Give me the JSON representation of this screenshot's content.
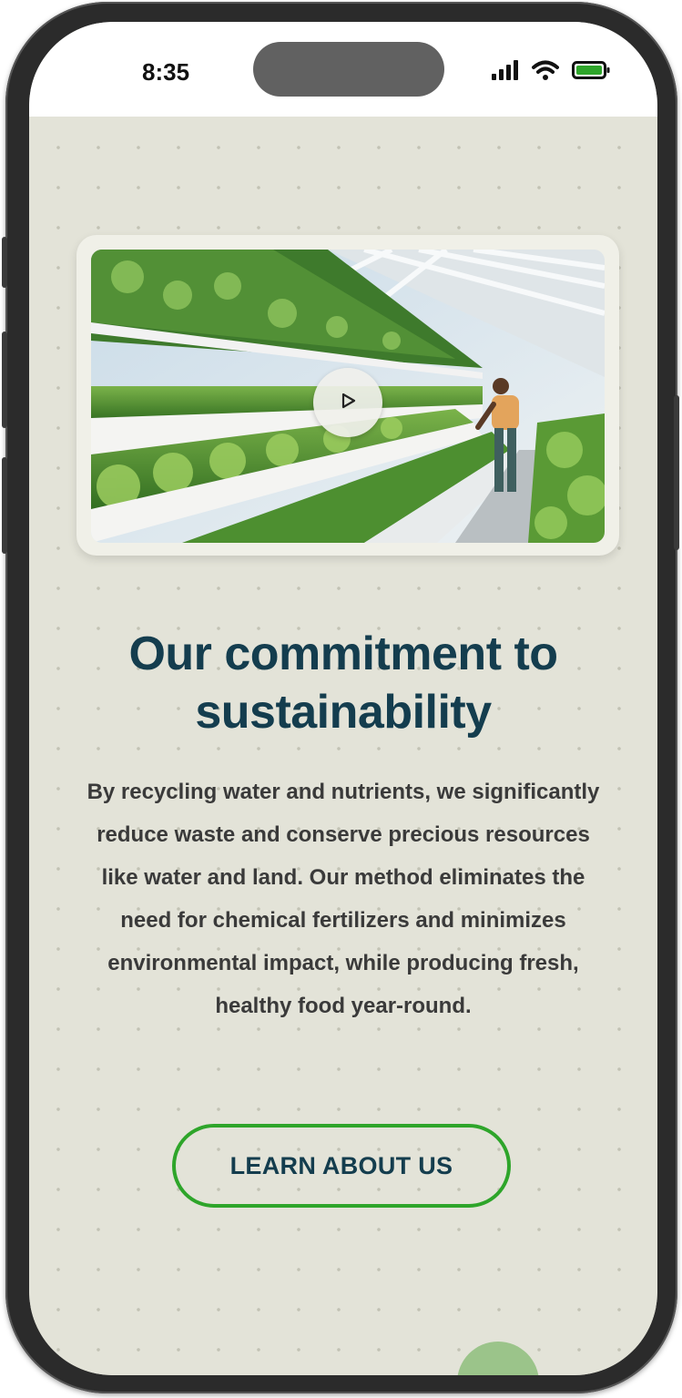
{
  "status_bar": {
    "time": "8:35",
    "icons": [
      "signal-icon",
      "wifi-icon",
      "battery-icon"
    ],
    "battery_color": "#2ea52a"
  },
  "video": {
    "play_icon": "play-icon"
  },
  "section": {
    "headline": "Our commitment to sustainability",
    "body": "By recycling water and nutrients, we significantly reduce waste and conserve precious resources like water and land. Our method eliminates the need for chemical fertilizers and minimizes environmental impact, while producing fresh, healthy food year-round.",
    "cta_label": "LEARN ABOUT US"
  },
  "colors": {
    "background": "#e3e3d8",
    "heading": "#143d4e",
    "accent": "#2ea52a",
    "fab": "#9bc48a"
  }
}
